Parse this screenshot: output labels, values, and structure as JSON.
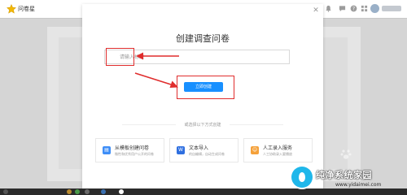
{
  "app": {
    "brand": "问卷星"
  },
  "header": {
    "icons": [
      "bell-icon",
      "message-icon",
      "help-icon",
      "grid-icon"
    ]
  },
  "modal": {
    "title": "创建调查问卷",
    "input_placeholder": "请输入标题",
    "create_label": "立即创建",
    "close_icon": "close-icon",
    "other_label": "或选择以下方式创建",
    "options": [
      {
        "title": "从模板创建问卷",
        "desc": "微性和优秀用户公开的问卷",
        "icon": "template-icon",
        "color": "#3e8ef7"
      },
      {
        "title": "文本导入",
        "desc": "的自编辑，自动生成问卷",
        "icon": "text-import-icon",
        "color": "#2f6fe0"
      },
      {
        "title": "人工录入服务",
        "desc": "人工协助录入要播放",
        "icon": "manual-service-icon",
        "color": "#f5a13a"
      }
    ]
  },
  "watermark": {
    "title": "纯净系统家园",
    "url": "www.yidaimei.com"
  },
  "colors": {
    "primary": "#1890ff",
    "highlight": "#e02d2d",
    "taskbar": "#2b2b2b"
  }
}
